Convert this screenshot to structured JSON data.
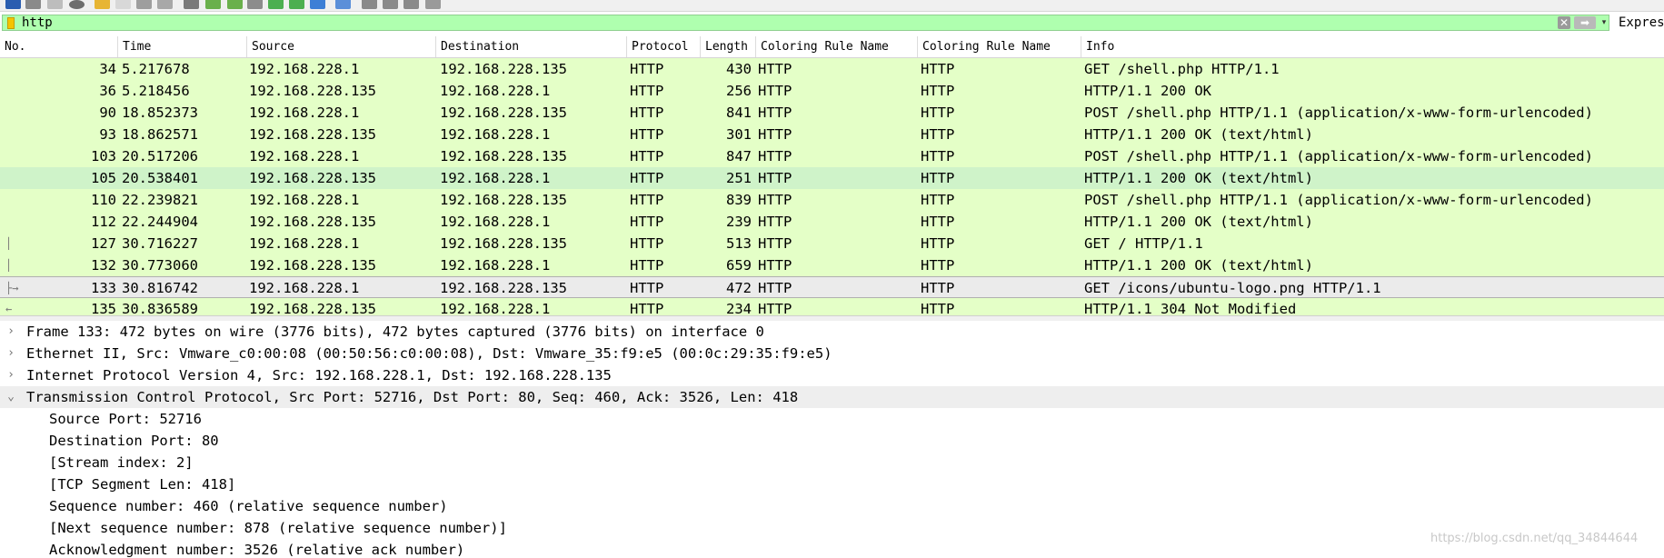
{
  "filter": {
    "value": "http",
    "clear_glyph": "✕",
    "apply_glyph": "➡",
    "dropdown_glyph": "▾",
    "expression_label": "Expres"
  },
  "columns": [
    "No.",
    "Time",
    "Source",
    "Destination",
    "Protocol",
    "Length",
    "Coloring Rule Name",
    "Coloring Rule Name",
    "Info"
  ],
  "packets": [
    {
      "no": "34",
      "time": "5.217678",
      "source": "192.168.228.1",
      "destination": "192.168.228.135",
      "protocol": "HTTP",
      "length": "430",
      "rule1": "HTTP",
      "rule2": "HTTP",
      "info": "GET /shell.php HTTP/1.1"
    },
    {
      "no": "36",
      "time": "5.218456",
      "source": "192.168.228.135",
      "destination": "192.168.228.1",
      "protocol": "HTTP",
      "length": "256",
      "rule1": "HTTP",
      "rule2": "HTTP",
      "info": "HTTP/1.1 200 OK"
    },
    {
      "no": "90",
      "time": "18.852373",
      "source": "192.168.228.1",
      "destination": "192.168.228.135",
      "protocol": "HTTP",
      "length": "841",
      "rule1": "HTTP",
      "rule2": "HTTP",
      "info": "POST /shell.php HTTP/1.1  (application/x-www-form-urlencoded)"
    },
    {
      "no": "93",
      "time": "18.862571",
      "source": "192.168.228.135",
      "destination": "192.168.228.1",
      "protocol": "HTTP",
      "length": "301",
      "rule1": "HTTP",
      "rule2": "HTTP",
      "info": "HTTP/1.1 200 OK  (text/html)"
    },
    {
      "no": "103",
      "time": "20.517206",
      "source": "192.168.228.1",
      "destination": "192.168.228.135",
      "protocol": "HTTP",
      "length": "847",
      "rule1": "HTTP",
      "rule2": "HTTP",
      "info": "POST /shell.php HTTP/1.1  (application/x-www-form-urlencoded)"
    },
    {
      "no": "105",
      "time": "20.538401",
      "source": "192.168.228.135",
      "destination": "192.168.228.1",
      "protocol": "HTTP",
      "length": "251",
      "rule1": "HTTP",
      "rule2": "HTTP",
      "info": "HTTP/1.1 200 OK  (text/html)"
    },
    {
      "no": "110",
      "time": "22.239821",
      "source": "192.168.228.1",
      "destination": "192.168.228.135",
      "protocol": "HTTP",
      "length": "839",
      "rule1": "HTTP",
      "rule2": "HTTP",
      "info": "POST /shell.php HTTP/1.1  (application/x-www-form-urlencoded)"
    },
    {
      "no": "112",
      "time": "22.244904",
      "source": "192.168.228.135",
      "destination": "192.168.228.1",
      "protocol": "HTTP",
      "length": "239",
      "rule1": "HTTP",
      "rule2": "HTTP",
      "info": "HTTP/1.1 200 OK  (text/html)"
    },
    {
      "no": "127",
      "time": "30.716227",
      "source": "192.168.228.1",
      "destination": "192.168.228.135",
      "protocol": "HTTP",
      "length": "513",
      "rule1": "HTTP",
      "rule2": "HTTP",
      "info": "GET / HTTP/1.1"
    },
    {
      "no": "132",
      "time": "30.773060",
      "source": "192.168.228.135",
      "destination": "192.168.228.1",
      "protocol": "HTTP",
      "length": "659",
      "rule1": "HTTP",
      "rule2": "HTTP",
      "info": "HTTP/1.1 200 OK  (text/html)"
    },
    {
      "no": "133",
      "time": "30.816742",
      "source": "192.168.228.1",
      "destination": "192.168.228.135",
      "protocol": "HTTP",
      "length": "472",
      "rule1": "HTTP",
      "rule2": "HTTP",
      "info": "GET /icons/ubuntu-logo.png HTTP/1.1"
    },
    {
      "no": "135",
      "time": "30.836589",
      "source": "192.168.228.135",
      "destination": "192.168.228.1",
      "protocol": "HTTP",
      "length": "234",
      "rule1": "HTTP",
      "rule2": "HTTP",
      "info": "HTTP/1.1 304 Not Modified"
    }
  ],
  "details": {
    "frame": "Frame 133: 472 bytes on wire (3776 bits), 472 bytes captured (3776 bits) on interface 0",
    "ethernet": "Ethernet II, Src: Vmware_c0:00:08 (00:50:56:c0:00:08), Dst: Vmware_35:f9:e5 (00:0c:29:35:f9:e5)",
    "ip": "Internet Protocol Version 4, Src: 192.168.228.1, Dst: 192.168.228.135",
    "tcp": "Transmission Control Protocol, Src Port: 52716, Dst Port: 80, Seq: 460, Ack: 3526, Len: 418",
    "tcp_fields": [
      "Source Port: 52716",
      "Destination Port: 80",
      "[Stream index: 2]",
      "[TCP Segment Len: 418]",
      "Sequence number: 460    (relative sequence number)",
      "[Next sequence number: 878    (relative sequence number)]",
      "Acknowledgment number: 3526    (relative ack number)"
    ],
    "collapsed_arrow": "›",
    "expanded_arrow": "⌄"
  },
  "watermark": "https://blog.csdn.net/qq_34844644",
  "colors": {
    "filter_valid": "#afffaf",
    "http_row": "#e4ffc7",
    "selected_row": "#ebebeb"
  }
}
